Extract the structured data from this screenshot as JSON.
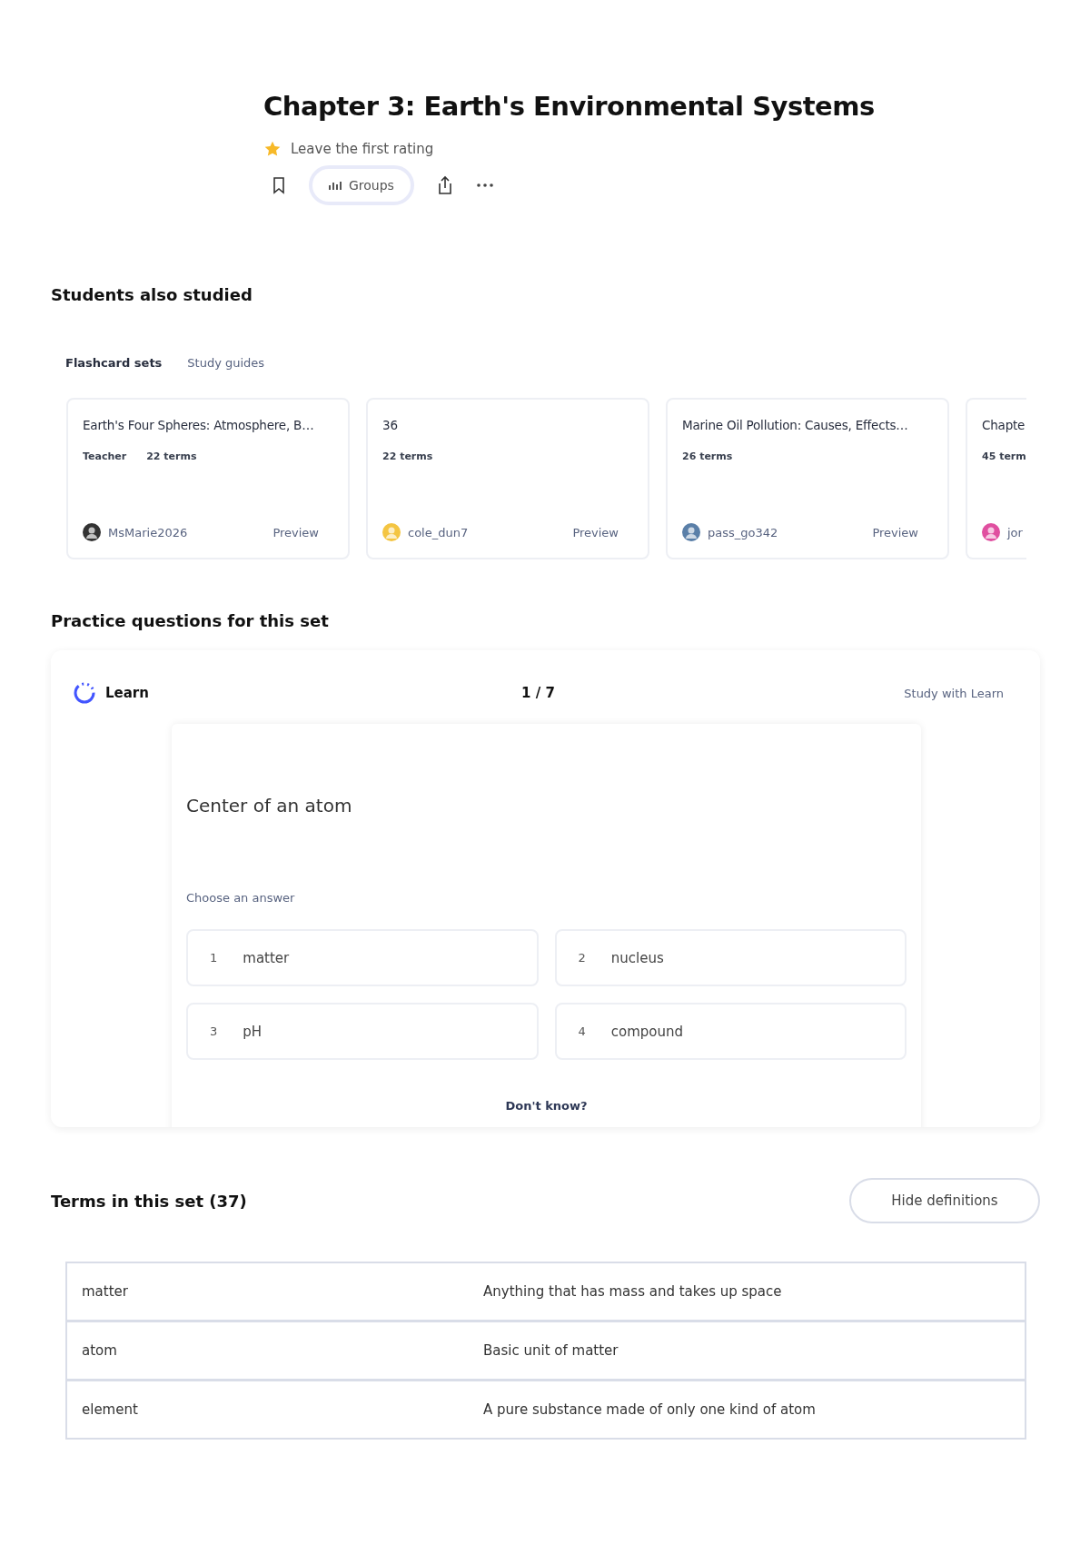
{
  "title": "Chapter 3: Earth's Environmental Systems",
  "rating": {
    "label": "Leave the first rating"
  },
  "actions": {
    "groups_label": "Groups"
  },
  "also_studied": {
    "heading": "Students also studied",
    "tabs": [
      {
        "label": "Flashcard sets",
        "selected": true
      },
      {
        "label": "Study guides",
        "selected": false
      }
    ],
    "cards": [
      {
        "title": "Earth's Four Spheres: Atmosphere, B…",
        "badge": "Teacher",
        "terms": "22 terms",
        "user": "MsMarie2026",
        "preview": "Preview"
      },
      {
        "title": "36",
        "terms": "22 terms",
        "user": "cole_dun7",
        "preview": "Preview"
      },
      {
        "title": "Marine Oil Pollution: Causes, Effects…",
        "terms": "26 terms",
        "user": "pass_go342",
        "preview": "Preview"
      },
      {
        "title": "Chapte",
        "terms": "45 term",
        "user": "jor"
      }
    ]
  },
  "practice": {
    "heading": "Practice questions for this set",
    "mode": "Learn",
    "progress": "1 / 7",
    "study_link": "Study with Learn",
    "question": "Center of an atom",
    "prompt": "Choose an answer",
    "answers": [
      {
        "number": "1",
        "text": "matter"
      },
      {
        "number": "2",
        "text": "nucleus"
      },
      {
        "number": "3",
        "text": "pH"
      },
      {
        "number": "4",
        "text": "compound"
      }
    ],
    "dont_know": "Don't know?"
  },
  "terms": {
    "heading": "Terms in this set (37)",
    "toggle": "Hide definitions",
    "rows": [
      {
        "term": "matter",
        "definition": "Anything that has mass and takes up space"
      },
      {
        "term": "atom",
        "definition": "Basic unit of matter"
      },
      {
        "term": "element",
        "definition": "A pure substance made of only one kind of atom"
      }
    ]
  }
}
